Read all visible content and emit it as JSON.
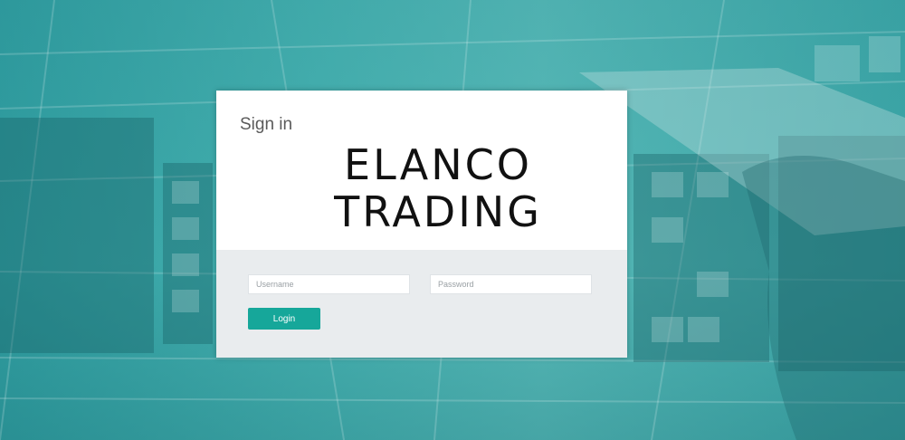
{
  "signin": {
    "title": "Sign in",
    "logo_line1": "ELANCO",
    "logo_line2": "TRADING",
    "username_placeholder": "Username",
    "password_placeholder": "Password",
    "username_value": "",
    "password_value": "",
    "login_label": "Login"
  },
  "colors": {
    "background": "#3aa9aa",
    "card_top": "#ffffff",
    "card_bottom": "#e9ecee",
    "button": "#16a79a",
    "button_text": "#ffffff"
  }
}
